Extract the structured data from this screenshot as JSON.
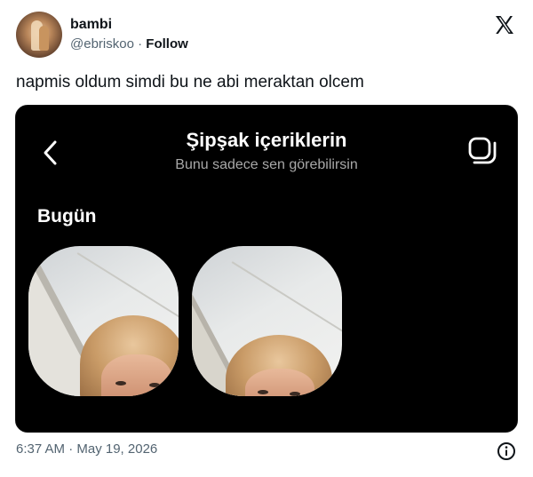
{
  "author": {
    "name": "bambi",
    "handle": "@ebriskoo",
    "separator": "·",
    "follow_label": "Follow"
  },
  "tweet": {
    "text": "napmis oldum simdi bu ne abi meraktan olcem",
    "timestamp": "6:37 AM · May 19, 2026"
  },
  "media": {
    "title": "Şipşak içeriklerin",
    "subtitle": "Bunu sadece sen görebilirsin",
    "section": "Bugün",
    "background_color": "#000000"
  },
  "icons": {
    "brand": "x-logo-icon",
    "back": "chevron-left-icon",
    "stack": "stack-icon",
    "info": "info-icon"
  }
}
